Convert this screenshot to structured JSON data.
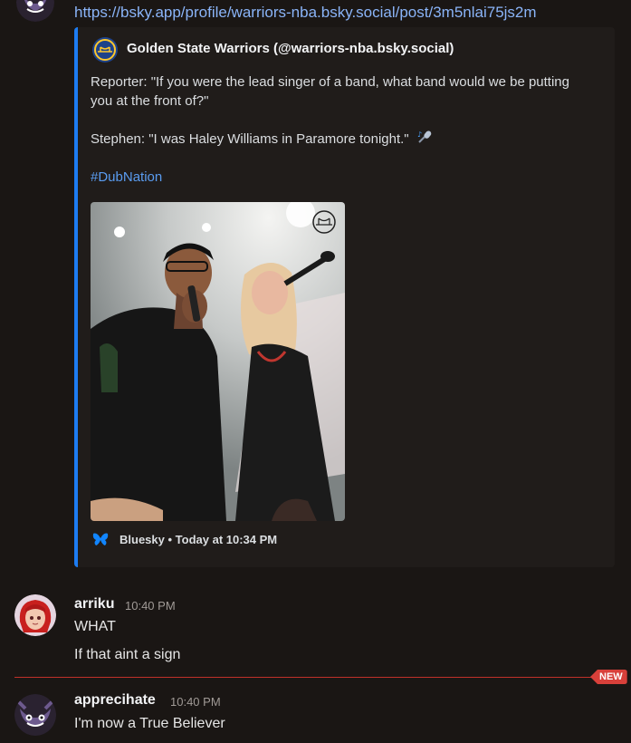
{
  "message_top": {
    "link": "https://bsky.app/profile/warriors-nba.bsky.social/post/3m5nlai75js2m"
  },
  "embed": {
    "author": "Golden State Warriors (@warriors-nba.bsky.social)",
    "line1": "Reporter: \"If you were the lead singer of a band, what band would we be putting",
    "line2": "you at the front of?\"",
    "line3": "Stephen: \"I was Haley Williams in Paramore tonight.\"",
    "line3_emoji_icon": "microphone-icon",
    "hashtag": "#DubNation",
    "footer_source": "Bluesky",
    "footer_time": "Today at 10:34 PM",
    "footer_icon": "butterfly-icon",
    "border_color": "#1d7cf2"
  },
  "messages": [
    {
      "username": "arriku",
      "time": "10:40 PM",
      "lines": [
        "WHAT",
        "If that aint a sign"
      ]
    },
    {
      "username": "apprecihate",
      "time": "10:40 PM",
      "lines": [
        "I'm now a True Believer"
      ]
    }
  ],
  "divider": {
    "badge": "NEW",
    "color": "#d8403a"
  }
}
